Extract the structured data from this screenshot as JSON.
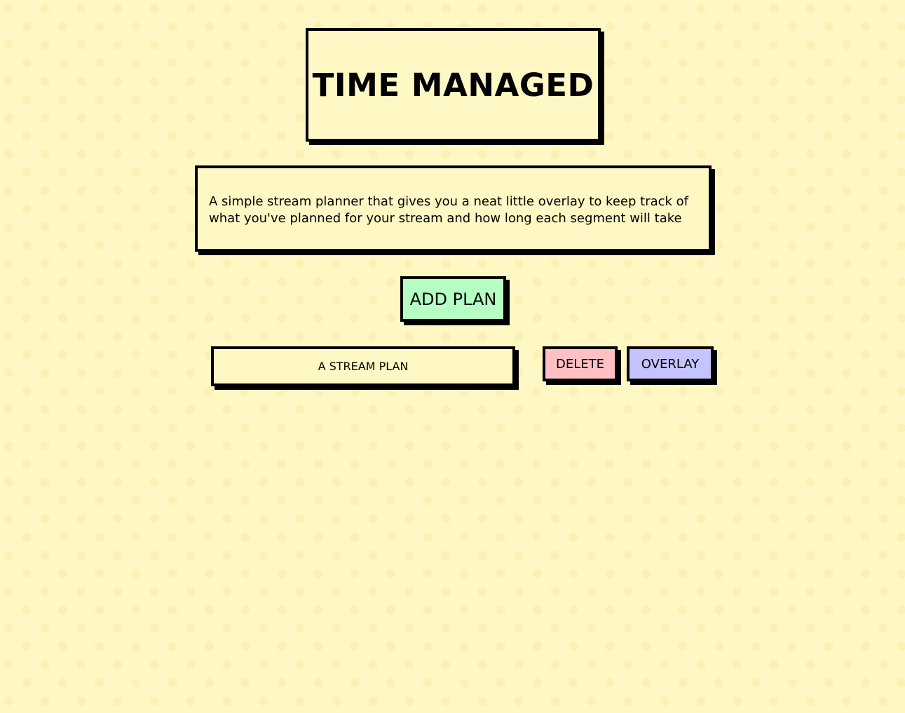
{
  "header": {
    "title": "TIME MANAGED"
  },
  "intro": {
    "description": "A simple stream planner that gives you a neat little overlay to keep track of what you've planned for your stream and how long each segment will take"
  },
  "actions": {
    "add_plan_label": "ADD PLAN"
  },
  "plans": [
    {
      "name": "A STREAM PLAN",
      "delete_label": "DELETE",
      "overlay_label": "OVERLAY"
    }
  ],
  "colors": {
    "background": "#fff8c4",
    "card": "#fff8c4",
    "add_button": "#b6ffc4",
    "delete_button": "#ffc0c4",
    "overlay_button": "#c6c4ff",
    "border": "#000000"
  }
}
